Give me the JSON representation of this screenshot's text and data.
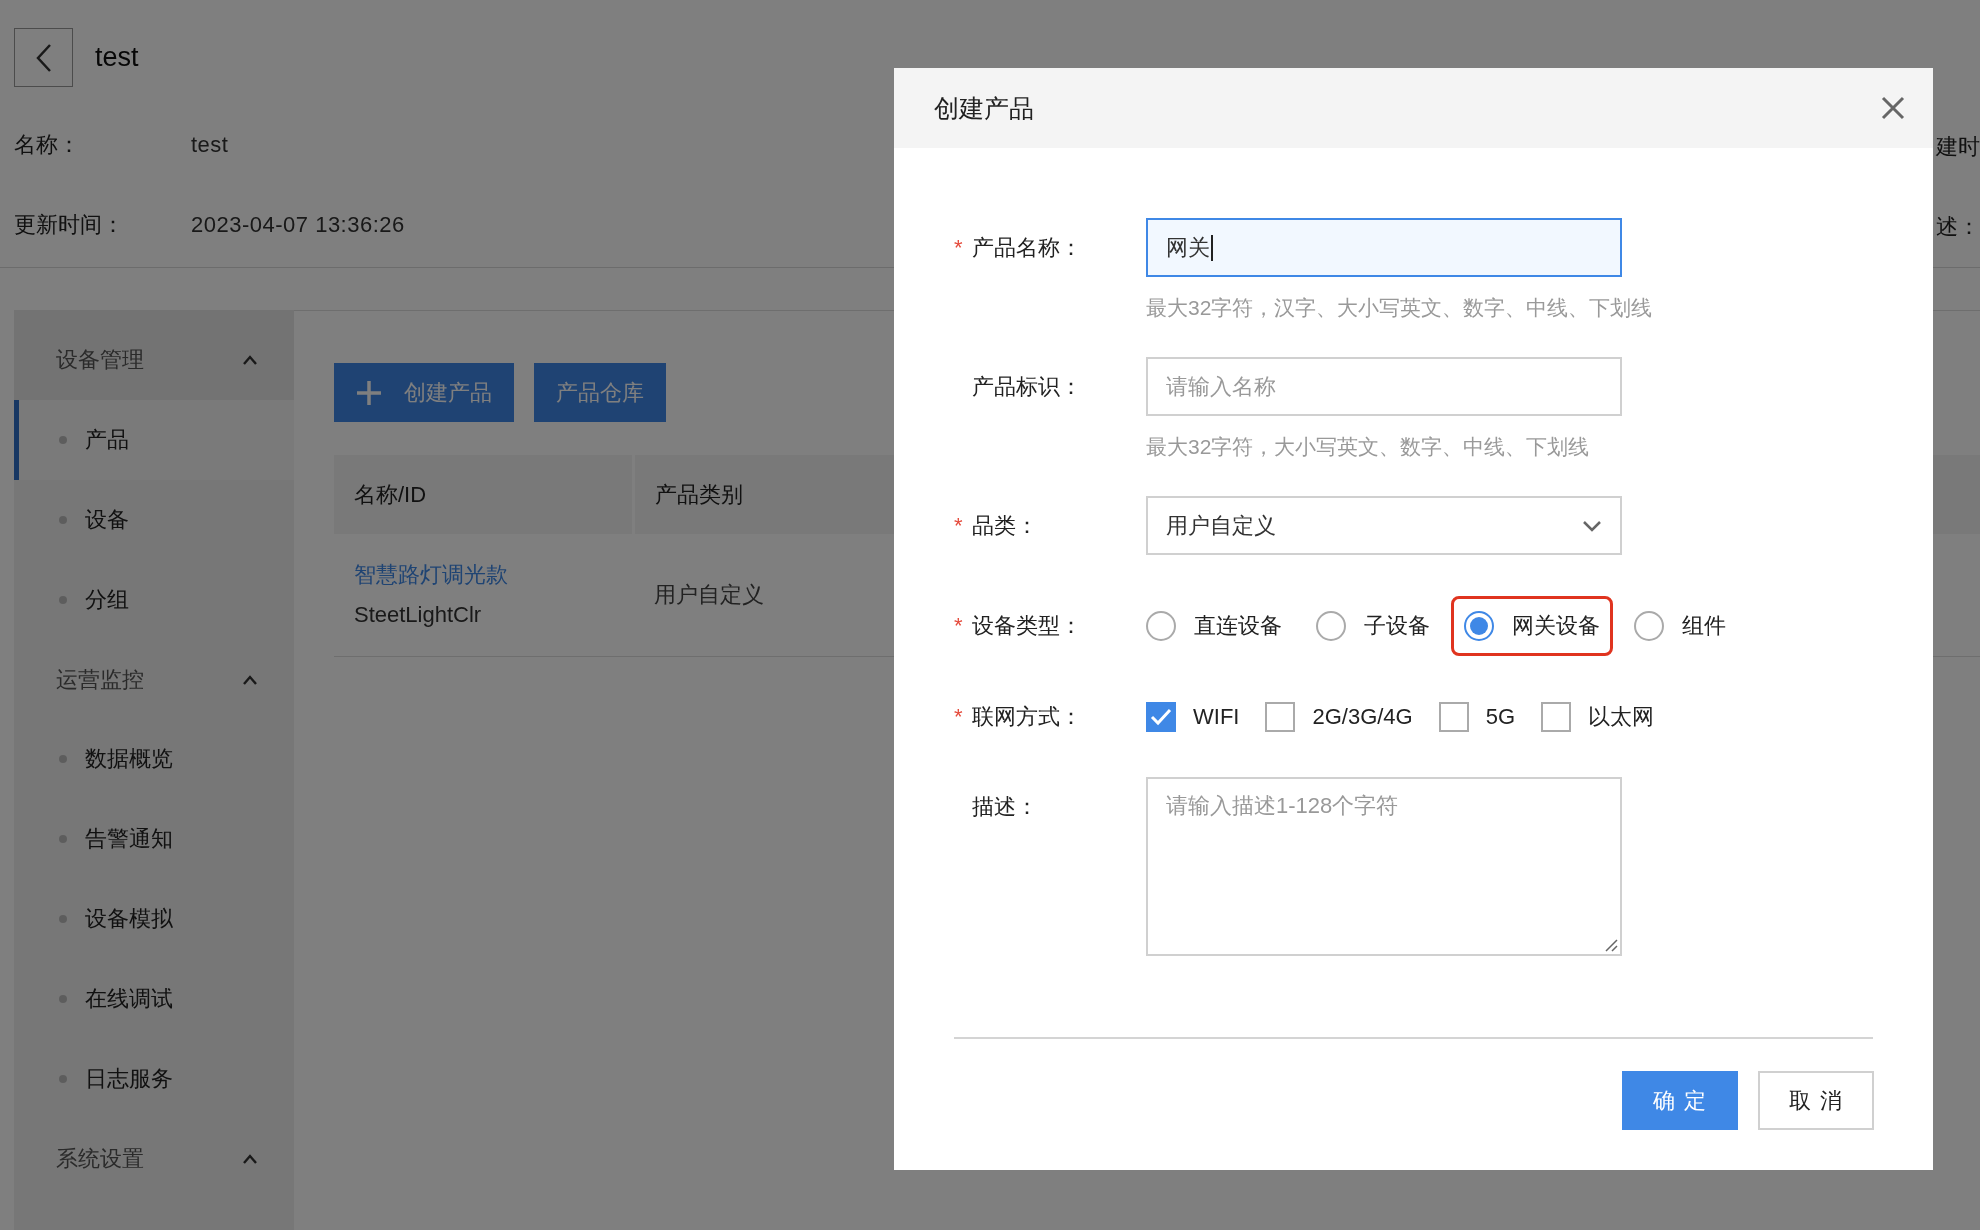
{
  "page": {
    "title": "test",
    "info": [
      {
        "label": "名称：",
        "value": "test"
      },
      {
        "label": "更新时间：",
        "value": "2023-04-07 13:36:26"
      }
    ],
    "info_right": [
      "建时",
      "述："
    ]
  },
  "sidebar": {
    "groups": [
      {
        "label": "设备管理",
        "expanded": true,
        "items": [
          {
            "label": "产品",
            "selected": true
          },
          {
            "label": "设备",
            "selected": false
          },
          {
            "label": "分组",
            "selected": false
          }
        ]
      },
      {
        "label": "运营监控",
        "expanded": true,
        "items": [
          {
            "label": "数据概览",
            "selected": false
          },
          {
            "label": "告警通知",
            "selected": false
          },
          {
            "label": "设备模拟",
            "selected": false
          },
          {
            "label": "在线调试",
            "selected": false
          },
          {
            "label": "日志服务",
            "selected": false
          }
        ]
      },
      {
        "label": "系统设置",
        "expanded": true
      }
    ]
  },
  "toolbar": {
    "buttons": [
      {
        "label": "创建产品",
        "kind": "add"
      },
      {
        "label": "产品仓库",
        "kind": "plain"
      }
    ]
  },
  "table": {
    "columns": [
      "名称/ID",
      "产品类别"
    ],
    "rows": [
      {
        "name": "智慧路灯调光款",
        "id": "SteetLightClr",
        "category": "用户自定义"
      }
    ]
  },
  "dialog": {
    "title": "创建产品",
    "fields": [
      {
        "kind": "text",
        "label": "产品名称：",
        "required_mark": "*",
        "value": "网关",
        "focused": true,
        "hint": "最大32字符，汉字、大小写英文、数字、中线、下划线"
      },
      {
        "kind": "text",
        "label": "产品标识：",
        "placeholder": "请输入名称",
        "focused": false,
        "hint": "最大32字符，大小写英文、数字、中线、下划线"
      },
      {
        "kind": "select",
        "label": "品类：",
        "required_mark": "*",
        "value": "用户自定义"
      },
      {
        "kind": "radio",
        "label": "设备类型：",
        "required_mark": "*",
        "options": [
          {
            "label": "直连设备",
            "selected": false,
            "highlighted": false
          },
          {
            "label": "子设备",
            "selected": false,
            "highlighted": false
          },
          {
            "label": "网关设备",
            "selected": true,
            "highlighted": true
          },
          {
            "label": "组件",
            "selected": false,
            "highlighted": false
          }
        ]
      },
      {
        "kind": "checkbox",
        "label": "联网方式：",
        "required_mark": "*",
        "options": [
          {
            "label": "WIFI",
            "checked": true
          },
          {
            "label": "2G/3G/4G",
            "checked": false
          },
          {
            "label": "5G",
            "checked": false
          },
          {
            "label": "以太网",
            "checked": false
          }
        ]
      },
      {
        "kind": "textarea",
        "label": "描述：",
        "placeholder": "请输入描述1-128个字符"
      }
    ],
    "buttons": [
      {
        "label": "确 定",
        "kind": "primary"
      },
      {
        "label": "取 消",
        "kind": "default"
      }
    ]
  }
}
